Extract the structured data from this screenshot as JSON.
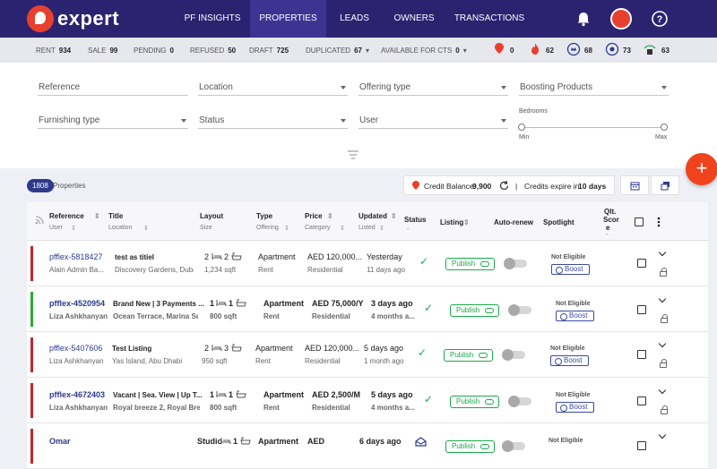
{
  "brand": {
    "name": "expert",
    "accent": "#e8402f",
    "nav_bg": "#2b2370"
  },
  "nav": {
    "items": [
      {
        "label": "PF INSIGHTS",
        "active": false
      },
      {
        "label": "PROPERTIES",
        "active": true
      },
      {
        "label": "LEADS",
        "active": false
      },
      {
        "label": "OWNERS",
        "active": false
      },
      {
        "label": "TRANSACTIONS",
        "active": false
      }
    ],
    "icons": [
      "bell-icon",
      "avatar",
      "help-icon"
    ],
    "help_glyph": "?"
  },
  "stats": [
    {
      "label": "RENT",
      "value": "934"
    },
    {
      "label": "SALE",
      "value": "99"
    },
    {
      "label": "PENDING",
      "value": "0"
    },
    {
      "label": "REFUSED",
      "value": "50"
    },
    {
      "label": "DRAFT",
      "value": "725"
    },
    {
      "label": "DUPLICATED",
      "value": "67"
    },
    {
      "label": "AVAILABLE FOR CTS",
      "value": "0"
    }
  ],
  "badges": [
    {
      "icon": "pin-icon",
      "value": "0"
    },
    {
      "icon": "flame-icon",
      "value": "62"
    },
    {
      "icon": "premium-icon",
      "value": "68"
    },
    {
      "icon": "spotlight-icon",
      "value": "73"
    },
    {
      "icon": "signal-lock-icon",
      "value": "63"
    }
  ],
  "filters": {
    "reference": "Reference",
    "location": "Location",
    "offering_type": "Offering type",
    "boosting_products": "Boosting Products",
    "furnishing_type": "Furnishing type",
    "status": "Status",
    "user": "User",
    "bedrooms": {
      "label": "Bedrooms",
      "min": "Min",
      "max": "Max"
    }
  },
  "summary": {
    "count": "1808",
    "count_label": "Properties",
    "credit_label": "Credit Balance:",
    "credit_value": "9,900",
    "separator": "|",
    "expire_text": "Credits expire in",
    "expire_value": "10 days",
    "fab_label": "+"
  },
  "table": {
    "headers": {
      "reference": "Reference",
      "user": "User",
      "title": "Title",
      "location": "Location",
      "layout": "Layout",
      "size": "Size",
      "type": "Type",
      "offering": "Offering",
      "price": "Price",
      "category": "Category",
      "updated": "Updated",
      "listed": "Listed",
      "status": "Status",
      "status_sub": "-",
      "listing": "Listing",
      "autorenew": "Auto-renew",
      "spotlight": "Spotlight",
      "qlt_1": "Qlt.",
      "qlt_2": "Scor",
      "qlt_3": "e",
      "qlt_sub": "-"
    },
    "rows": [
      {
        "ref": "pfflex-5818427",
        "user": "Alain Admin Ba...",
        "title": "test as titiel",
        "location": "Discovery Gardens, Dubai",
        "beds": "2",
        "baths": "2",
        "size": "1,234 sqft",
        "type": "Apartment",
        "offering": "Rent",
        "price": "AED 120,000...",
        "category": "Residential",
        "updated": "Yesterday",
        "listed": "11 days ago",
        "listing": "Publish",
        "spotlight": "Not Eligible",
        "boost": "Boost",
        "status_color": "#c62828",
        "bold": false
      },
      {
        "ref": "pfflex-4520954",
        "user": "Liza Ashkhanyan",
        "title": "Brand New | 3 Payments ...",
        "location": "Ocean Terrace, Marina Sq...",
        "beds": "1",
        "baths": "1",
        "size": "800 sqft",
        "type": "Apartment",
        "offering": "Rent",
        "price": "AED 75,000/Y",
        "category": "Residential",
        "updated": "3 days ago",
        "listed": "4 months a...",
        "listing": "Publish",
        "spotlight": "Not Eligible",
        "boost": "Boost",
        "status_color": "#2eaa3a",
        "bold": true
      },
      {
        "ref": "pfflex-5407606",
        "user": "Liza Ashkhanyan",
        "title": "Test Listing",
        "location": "Yas Island, Abu Dhabi",
        "beds": "2",
        "baths": "3",
        "size": "950 sqft",
        "type": "Apartment",
        "offering": "Rent",
        "price": "AED 120,000...",
        "category": "Residential",
        "updated": "5 days ago",
        "listed": "1 month ago",
        "listing": "Publish",
        "spotlight": "Not Eligible",
        "boost": "Boost",
        "status_color": "#c62828",
        "bold": false
      },
      {
        "ref": "pfflex-4672403",
        "user": "Liza Ashkhanyan",
        "title": "Vacant | Sea. View | Up T...",
        "location": "Royal breeze 2, Royal Bree...",
        "beds": "1",
        "baths": "1",
        "size": "800 sqft",
        "type": "Apartment",
        "offering": "Rent",
        "price": "AED 2,500/M",
        "category": "Residential",
        "updated": "5 days ago",
        "listed": "4 months a...",
        "listing": "Publish",
        "spotlight": "Not Eligible",
        "boost": "Boost",
        "status_color": "#c62828",
        "bold": true
      },
      {
        "ref": "Omar",
        "user": "",
        "title": "",
        "location": "",
        "beds": "Studio",
        "baths": "1",
        "size": "",
        "type": "Apartment",
        "offering": "",
        "price": "AED",
        "category": "",
        "updated": "6 days ago",
        "listed": "",
        "listing": "Publish",
        "spotlight": "Not Eligible",
        "boost": "",
        "status_color": "#c62828",
        "bold": true
      }
    ]
  }
}
